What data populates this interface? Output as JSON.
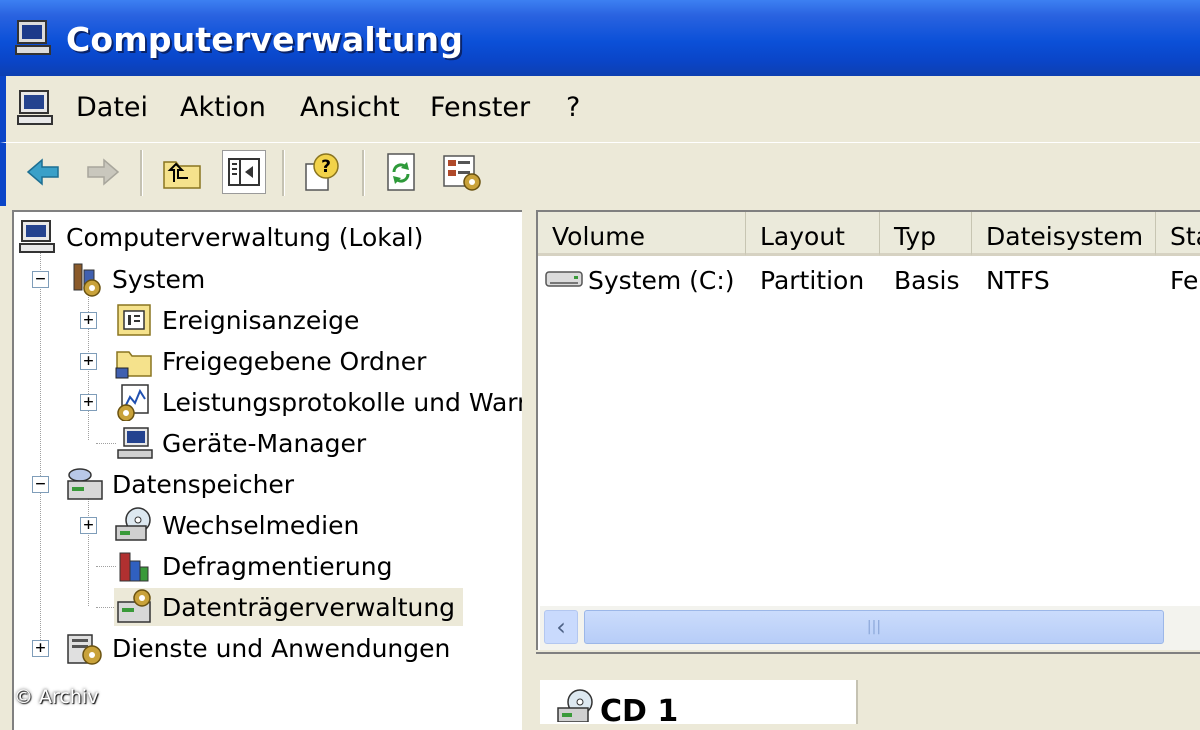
{
  "window": {
    "title": "Computerverwaltung"
  },
  "menu": [
    "Datei",
    "Aktion",
    "Ansicht",
    "Fenster",
    "?"
  ],
  "toolbar": {
    "icons": [
      "back-arrow-icon",
      "forward-arrow-icon",
      "up-folder-icon",
      "show-hide-tree-icon",
      "help-icon",
      "refresh-icon",
      "properties-icon"
    ]
  },
  "tree": {
    "root": "Computerverwaltung (Lokal)",
    "system": "System",
    "ereignis": "Ereignisanzeige",
    "freigegeben": "Freigegebene Ordner",
    "leistung": "Leistungsprotokolle und Warn",
    "geraete": "Geräte-Manager",
    "datenspeicher": "Datenspeicher",
    "wechselmedien": "Wechselmedien",
    "defrag": "Defragmentierung",
    "datentraeger": "Datenträgerverwaltung",
    "dienste": "Dienste und Anwendungen"
  },
  "list": {
    "columns": [
      "Volume",
      "Layout",
      "Typ",
      "Dateisystem",
      "Status"
    ],
    "rows": [
      {
        "volume": "System (C:)",
        "layout": "Partition",
        "typ": "Basis",
        "dateisystem": "NTFS",
        "status": "Fe"
      }
    ]
  },
  "disk": {
    "label": "CD 1"
  },
  "watermark": "© Archiv",
  "colors": {
    "titlebar": "#0a45c8",
    "window_bg": "#ece9d8",
    "selection": "#ece9d8"
  }
}
